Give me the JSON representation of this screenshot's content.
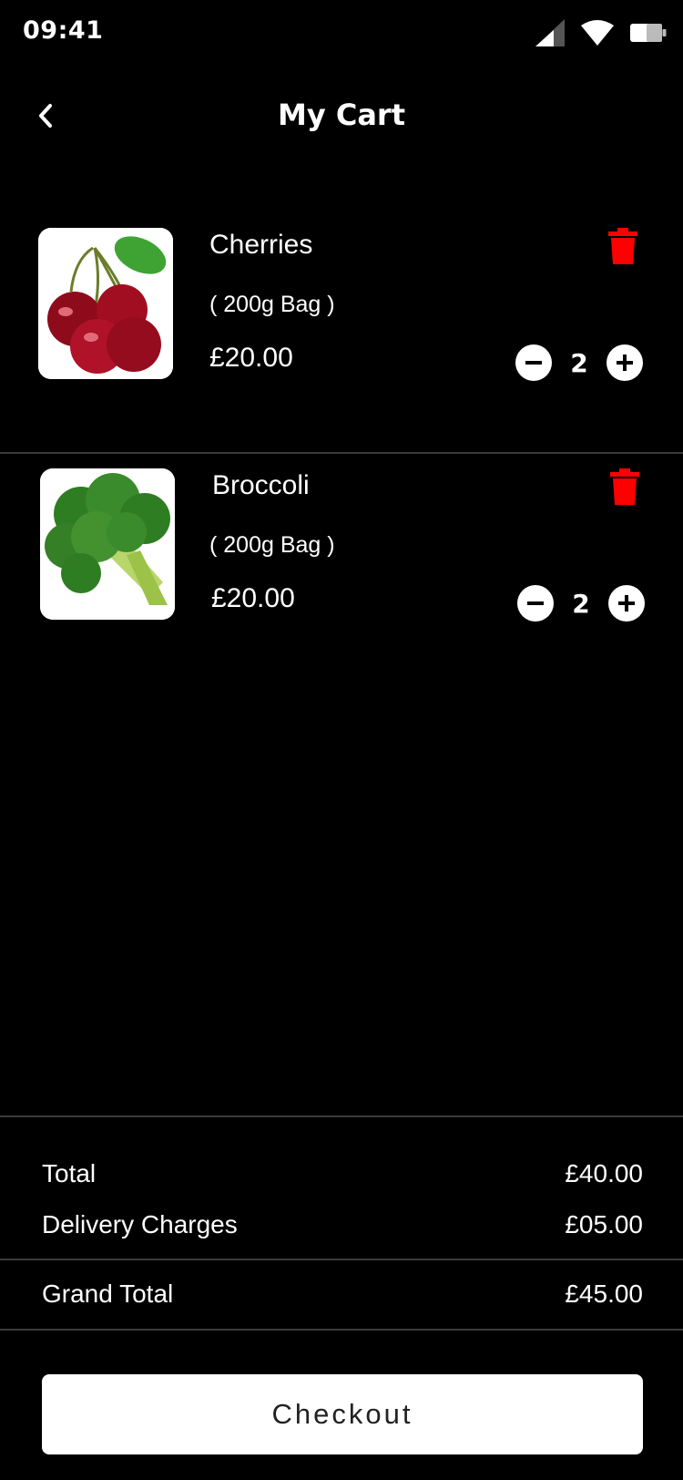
{
  "status_bar": {
    "time": "09:41"
  },
  "header": {
    "title": "My Cart",
    "back_icon": "chevron-left-icon"
  },
  "cart": {
    "items": [
      {
        "name": "Cherries",
        "pack": "( 200g Bag )",
        "price": "£20.00",
        "quantity": "2",
        "image": "cherries-image"
      },
      {
        "name": "Broccoli",
        "pack": "( 200g Bag )",
        "price": "£20.00",
        "quantity": "2",
        "image": "broccoli-image"
      }
    ]
  },
  "summary": {
    "total_label": "Total",
    "total_value": "£40.00",
    "delivery_label": "Delivery Charges",
    "delivery_value": "£05.00",
    "grand_total_label": "Grand Total",
    "grand_total_value": "£45.00"
  },
  "checkout": {
    "label": "Checkout"
  },
  "colors": {
    "background": "#000000",
    "delete": "#ff0000",
    "divider": "#3b3b3b",
    "button_bg": "#ffffff"
  }
}
